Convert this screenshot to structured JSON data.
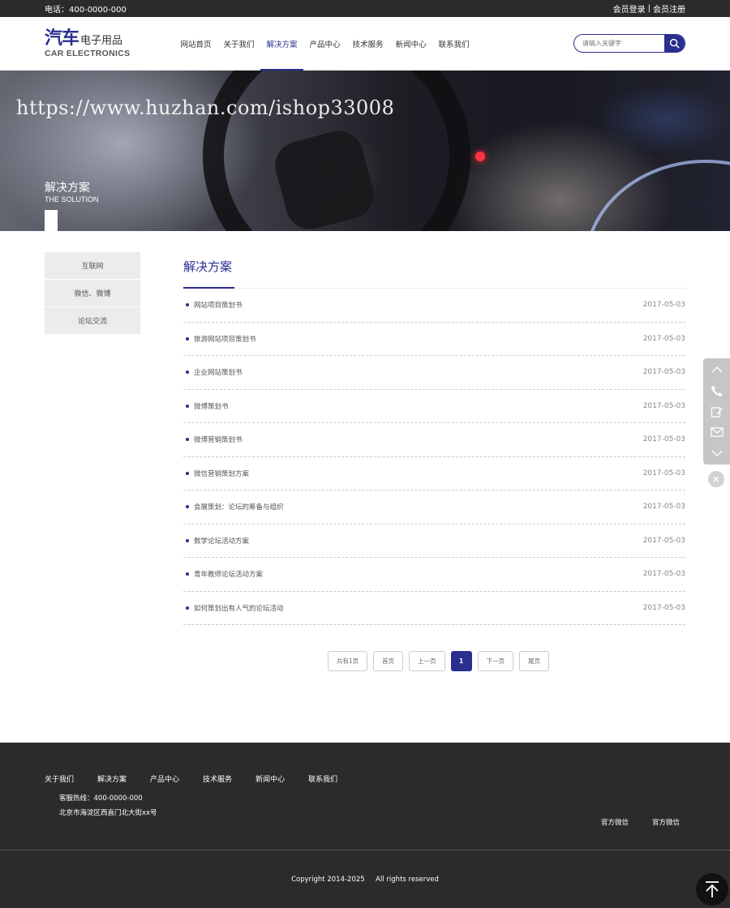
{
  "topbar": {
    "phone": "电话：400-0000-000",
    "login": "会员登录",
    "separator": "|",
    "register": "会员注册"
  },
  "logo": {
    "main": "汽车",
    "sub": "电子用品",
    "en": "CAR ELECTRONICS"
  },
  "nav": [
    {
      "label": "网站首页",
      "active": false
    },
    {
      "label": "关于我们",
      "active": false
    },
    {
      "label": "解决方案",
      "active": true
    },
    {
      "label": "产品中心",
      "active": false
    },
    {
      "label": "技术服务",
      "active": false
    },
    {
      "label": "新闻中心",
      "active": false
    },
    {
      "label": "联系我们",
      "active": false
    }
  ],
  "search": {
    "placeholder": "请输入关键字",
    "icon": "search-icon"
  },
  "banner": {
    "watermark": "https://www.huzhan.com/ishop33008",
    "title": "解决方案",
    "subtitle": "THE SOLUTION"
  },
  "sidebar": {
    "items": [
      "互联网",
      "微信、微博",
      "论坛交流"
    ]
  },
  "main": {
    "title": "解决方案",
    "articles": [
      {
        "title": "网站项目策划书",
        "date": "2017-05-03"
      },
      {
        "title": "旅游网站项目策划书",
        "date": "2017-05-03"
      },
      {
        "title": "企业网站策划书",
        "date": "2017-05-03"
      },
      {
        "title": "微博策划书",
        "date": "2017-05-03"
      },
      {
        "title": "微博营销策划书",
        "date": "2017-05-03"
      },
      {
        "title": "微信营销策划方案",
        "date": "2017-05-03"
      },
      {
        "title": "会展策划：论坛的筹备与组织",
        "date": "2017-05-03"
      },
      {
        "title": "数学论坛活动方案",
        "date": "2017-05-03"
      },
      {
        "title": "青年教师论坛活动方案",
        "date": "2017-05-03"
      },
      {
        "title": "如何策划出有人气的论坛活动",
        "date": "2017-05-03"
      }
    ]
  },
  "pager": {
    "total": "共有1页",
    "first": "首页",
    "prev": "上一页",
    "current": "1",
    "next": "下一页",
    "last": "尾页"
  },
  "float_tools": [
    "chevron-up-icon",
    "phone-icon",
    "edit-icon",
    "mail-icon",
    "chevron-down-icon",
    "close-icon"
  ],
  "footer": {
    "nav": [
      "关于我们",
      "解决方案",
      "产品中心",
      "技术服务",
      "新闻中心",
      "联系我们"
    ],
    "hotline": "客服热线：400-0000-000",
    "address": "北京市海淀区西直门北大街xx号",
    "wechat1": "官方微信",
    "wechat2": "官方微信",
    "copyright": "Copyright 2014-2025     All rights reserved"
  },
  "colors": {
    "accent": "#2a2e8f",
    "dark": "#2b2b2b"
  }
}
